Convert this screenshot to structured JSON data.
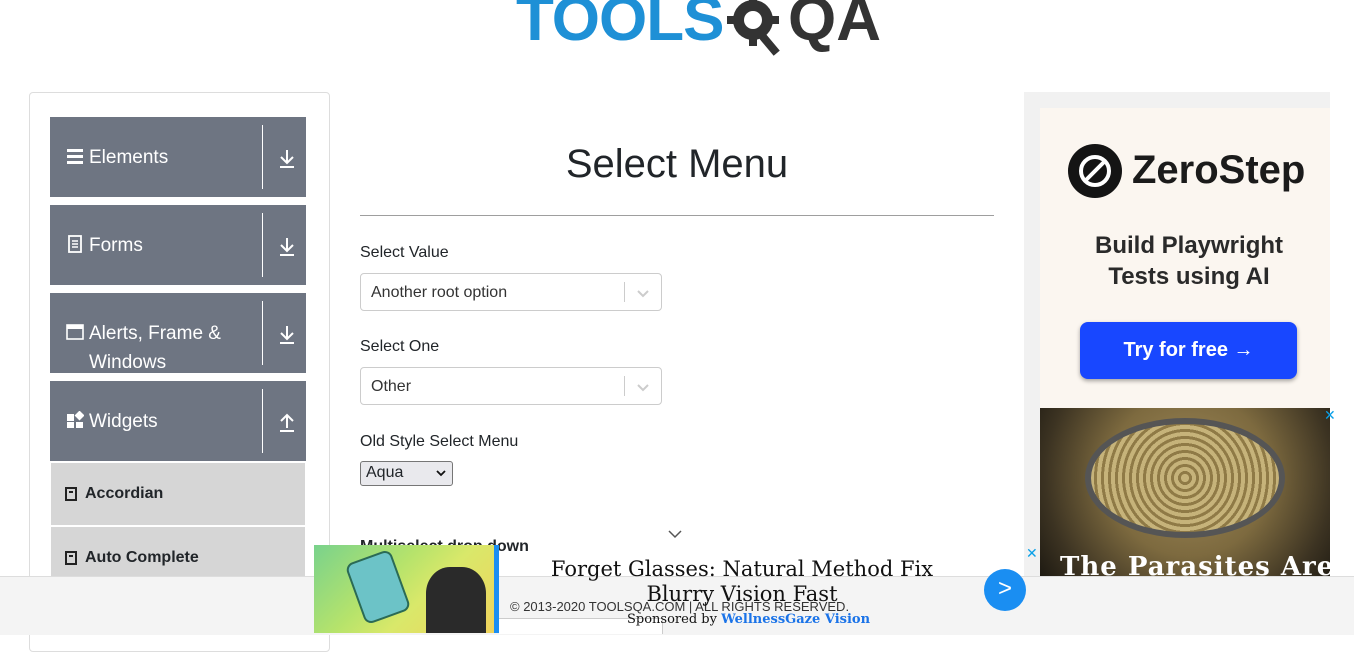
{
  "logo": {
    "part1": "TOOLS",
    "part2": "QA"
  },
  "sidebar": {
    "groups": [
      {
        "label": "Elements",
        "icon": "hamburger-icon",
        "arrow": "download-arrow-icon"
      },
      {
        "label": "Forms",
        "icon": "document-icon",
        "arrow": "download-arrow-icon"
      },
      {
        "label": "Alerts, Frame & Windows",
        "icon": "window-icon",
        "arrow": "download-arrow-icon"
      },
      {
        "label": "Widgets",
        "icon": "widgets-icon",
        "arrow": "upload-arrow-icon"
      }
    ],
    "widget_items": [
      {
        "label": "Accordian",
        "icon": "book-icon"
      },
      {
        "label": "Auto Complete",
        "icon": "book-icon"
      }
    ]
  },
  "main": {
    "title": "Select Menu",
    "select_value": {
      "label": "Select Value",
      "value": "Another root option"
    },
    "select_one": {
      "label": "Select One",
      "value": "Other"
    },
    "old_style": {
      "label": "Old Style Select Menu",
      "value": "Aqua"
    },
    "multiselect": {
      "label": "Multiselect drop down"
    }
  },
  "ads": {
    "right": {
      "brand": "ZeroStep",
      "tagline": "Build Playwright Tests using AI",
      "cta": "Try for free →",
      "caption": "The Parasites Are",
      "close": "✕"
    },
    "bottom": {
      "headline": "Forget Glasses: Natural Method Fix Blurry Vision Fast",
      "sponsored_prefix": "Sponsored by",
      "sponsor": "WellnessGaze Vision",
      "go": ">",
      "close": "✕"
    }
  },
  "footer": {
    "copyright": "© 2013-2020 TOOLSQA.COM | ALL RIGHTS RESERVED."
  },
  "colors": {
    "group_bg": "#6e7582",
    "brand_blue": "#1e90d6",
    "cta_blue": "#1847ff"
  }
}
